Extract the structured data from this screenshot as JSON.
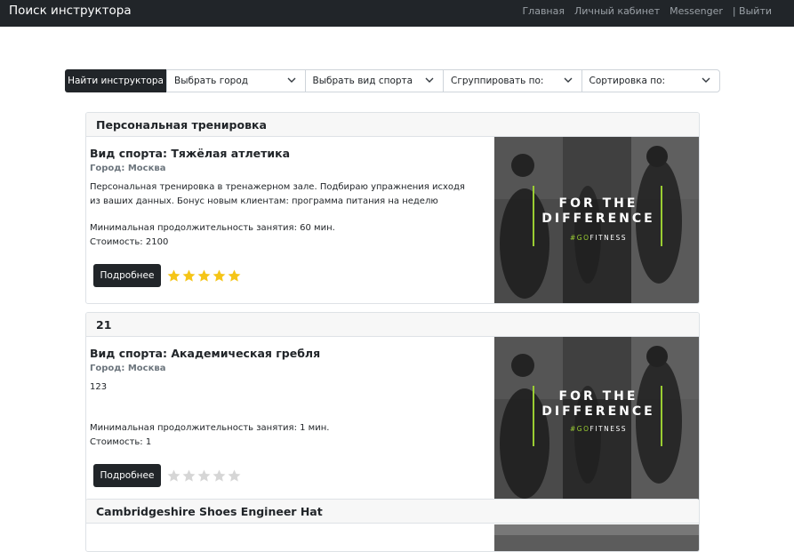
{
  "navbar": {
    "brand": "Поиск инструктора",
    "links": [
      "Главная",
      "Личный кабинет",
      "Messenger",
      "| Выйти"
    ]
  },
  "filters": {
    "find_label": "Найти инструктора",
    "city": "Выбрать город",
    "sport": "Выбрать вид спорта",
    "group": "Сгруппировать по:",
    "sort": "Сортировка по:"
  },
  "cards": [
    {
      "title": "Персональная тренировка",
      "sport": "Вид спорта: Тяжёлая атлетика",
      "city": "Город: Москва",
      "description": "Персональная тренировка в тренажерном зале. Подбираю упражнения исходя из ваших данных. Бонус новым клиентам: программа питания на неделю",
      "duration": "Минимальная продолжительность занятия: 60 мин.",
      "price": "Стоимость: 2100",
      "button": "Подробнее",
      "rating": 5
    },
    {
      "title": "21",
      "sport": "Вид спорта: Академическая гребля",
      "city": "Город: Москва",
      "description": "123",
      "duration": "Минимальная продолжительность занятия: 1 мин.",
      "price": "Стоимость: 1",
      "button": "Подробнее",
      "rating": 0
    },
    {
      "title": "Cambridgeshire Shoes Engineer Hat"
    }
  ],
  "image_text": {
    "line1": "FOR THE",
    "line2": "DIFFERENCE",
    "line3_accent": "#GO",
    "line3_rest": "FITNESS"
  },
  "colors": {
    "navbar_bg": "#212529",
    "star_filled": "#f5c518",
    "star_empty": "#d6d6d6",
    "accent_green": "#9acd32"
  },
  "icons": {
    "filter_arrow": "chevron-down-icon",
    "rating": "star-icon"
  }
}
